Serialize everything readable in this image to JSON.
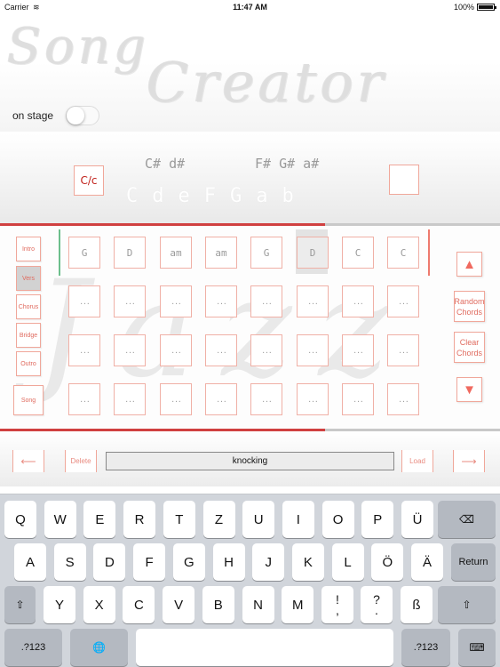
{
  "status_bar": {
    "carrier": "Carrier",
    "wifi_icon": "wifi-icon",
    "time": "11:47 AM",
    "battery": "100%",
    "battery_icon": "battery-icon"
  },
  "header": {
    "logo_line1": "Song",
    "logo_line2": "Creator",
    "stage_label": "on stage",
    "stage_toggle_on": false
  },
  "key_selector": {
    "current_key": "C/c",
    "sharps_group1": "C# d#",
    "sharps_group2": "F# G# a#",
    "naturals": "CdeFGab",
    "empty_key_slot": ""
  },
  "progress": {
    "top_fraction": 0.65,
    "bottom_fraction": 0.65
  },
  "sections": [
    {
      "label": "Intro",
      "active": false
    },
    {
      "label": "Vers",
      "active": true
    },
    {
      "label": "Chorus",
      "active": false
    },
    {
      "label": "Bridge",
      "active": false
    },
    {
      "label": "Outro",
      "active": false
    }
  ],
  "song_button": "Song",
  "watermark": "Jazz",
  "chord_rows": [
    [
      "G",
      "D",
      "am",
      "am",
      "G",
      "D",
      "C",
      "C"
    ],
    [
      "...",
      "...",
      "...",
      "...",
      "...",
      "...",
      "...",
      "..."
    ],
    [
      "...",
      "...",
      "...",
      "...",
      "...",
      "...",
      "...",
      "..."
    ],
    [
      "...",
      "...",
      "...",
      "...",
      "...",
      "...",
      "...",
      "..."
    ]
  ],
  "highlighted_cell": {
    "row": 0,
    "col": 5
  },
  "side_controls": {
    "up": "▲",
    "random": "Random Chords",
    "clear": "Clear Chords",
    "down": "▼"
  },
  "bottom_bar": {
    "prev": "⟵",
    "delete": "Delete",
    "song_name": "knocking",
    "load": "Load",
    "next": "⟶"
  },
  "keyboard": {
    "row1": [
      "Q",
      "W",
      "E",
      "R",
      "T",
      "Z",
      "U",
      "I",
      "O",
      "P",
      "Ü"
    ],
    "backspace_icon": "⌫",
    "row2": [
      "A",
      "S",
      "D",
      "F",
      "G",
      "H",
      "J",
      "K",
      "L",
      "Ö",
      "Ä"
    ],
    "return": "Return",
    "shift_icon": "⇧",
    "row3": [
      "Y",
      "X",
      "C",
      "V",
      "B",
      "N",
      "M"
    ],
    "punct1_top": "!",
    "punct1_bottom": ",",
    "punct2_top": "?",
    "punct2_bottom": ".",
    "eszett": "ß",
    "numbers": ".?123",
    "globe_icon": "🌐",
    "space": "",
    "hide_icon": "⌨"
  }
}
